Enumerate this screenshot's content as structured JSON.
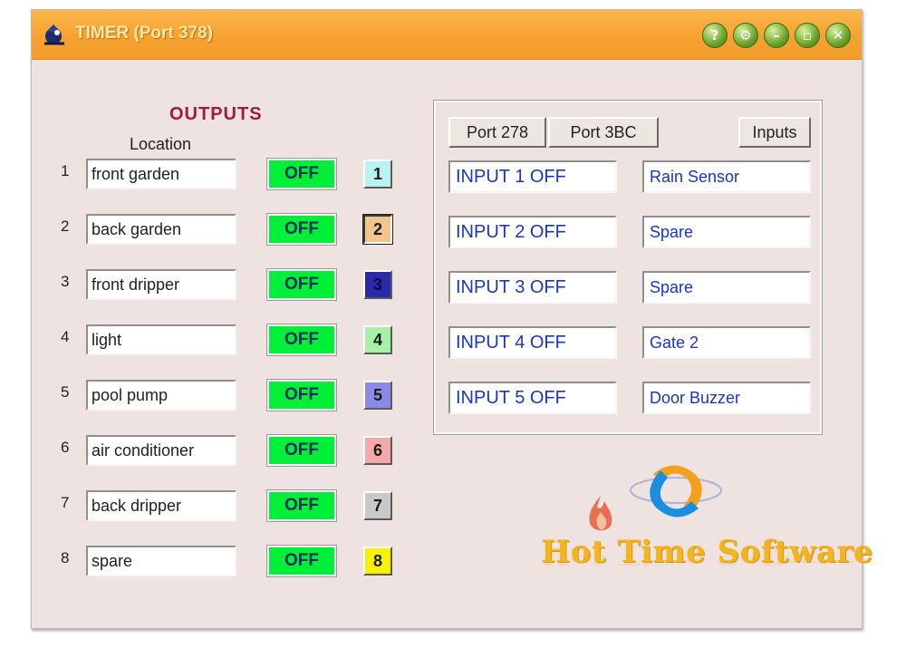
{
  "window": {
    "title": "TIMER (Port 378)"
  },
  "titlebar_buttons": [
    {
      "name": "help",
      "glyph": "?"
    },
    {
      "name": "settings",
      "glyph": "⚙"
    },
    {
      "name": "minimize",
      "glyph": "–"
    },
    {
      "name": "maximize",
      "glyph": "▫"
    },
    {
      "name": "close",
      "glyph": "✕"
    }
  ],
  "outputs": {
    "heading": "OUTPUTS",
    "location_label": "Location",
    "rows": [
      {
        "num": "1",
        "location": "front garden",
        "state": "OFF",
        "button": "1",
        "color": "#b8f2f2"
      },
      {
        "num": "2",
        "location": "back garden",
        "state": "OFF",
        "button": "2",
        "color": "#f4c48e"
      },
      {
        "num": "3",
        "location": "front dripper",
        "state": "OFF",
        "button": "3",
        "color": "#2a2aa8"
      },
      {
        "num": "4",
        "location": "light",
        "state": "OFF",
        "button": "4",
        "color": "#a8f0a8"
      },
      {
        "num": "5",
        "location": "pool pump",
        "state": "OFF",
        "button": "5",
        "color": "#8a8ae8"
      },
      {
        "num": "6",
        "location": "air conditioner",
        "state": "OFF",
        "button": "6",
        "color": "#f4a8a8"
      },
      {
        "num": "7",
        "location": "back dripper",
        "state": "OFF",
        "button": "7",
        "color": "#c8c8c8"
      },
      {
        "num": "8",
        "location": "spare",
        "state": "OFF",
        "button": "8",
        "color": "#f8f200"
      }
    ]
  },
  "inputs": {
    "port_buttons": [
      "Port 278",
      "Port 3BC"
    ],
    "inputs_button": "Inputs",
    "rows": [
      {
        "state": "INPUT 1 OFF",
        "label": "Rain Sensor"
      },
      {
        "state": "INPUT 2 OFF",
        "label": "Spare"
      },
      {
        "state": "INPUT 3 OFF",
        "label": "Spare"
      },
      {
        "state": "INPUT 4 OFF",
        "label": "Gate 2"
      },
      {
        "state": "INPUT 5 OFF",
        "label": "Door Buzzer"
      }
    ]
  },
  "logo": {
    "text": "Hot Time Software"
  },
  "colors": {
    "titlebar": "#f7a12f",
    "state_on_bg": "#00f03a",
    "input_text": "#1a35c8",
    "heading": "#a11a3e"
  }
}
